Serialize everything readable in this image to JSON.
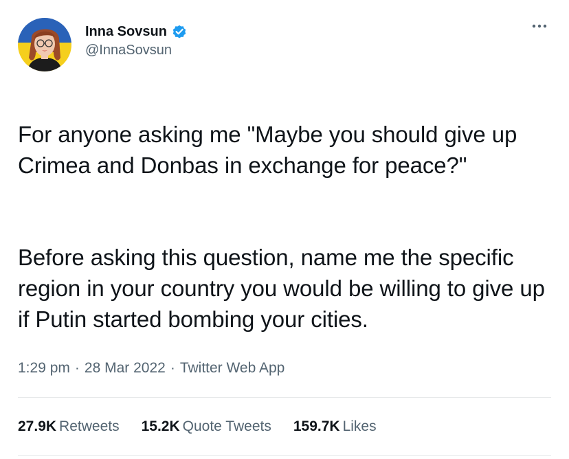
{
  "author": {
    "display_name": "Inna Sovsun",
    "handle": "@InnaSovsun",
    "verified": true,
    "verified_color": "#1d9bf0",
    "avatar_flag_colors": [
      "#2a62b8",
      "#f5cf1d"
    ]
  },
  "tweet": {
    "paragraphs": [
      "For anyone asking me \"Maybe you should give up Crimea and Donbas in exchange for peace?\"",
      "Before asking this question, name me the specific region in your country you would be willing to give up if Putin started bombing your cities."
    ],
    "time": "1:29 pm",
    "date": "28 Mar 2022",
    "source": "Twitter Web App",
    "separator": "·"
  },
  "stats": [
    {
      "value": "27.9K",
      "label": "Retweets"
    },
    {
      "value": "15.2K",
      "label": "Quote Tweets"
    },
    {
      "value": "159.7K",
      "label": "Likes"
    }
  ],
  "colors": {
    "text": "#0f1419",
    "secondary": "#536471",
    "divider": "#e7e9ea"
  }
}
